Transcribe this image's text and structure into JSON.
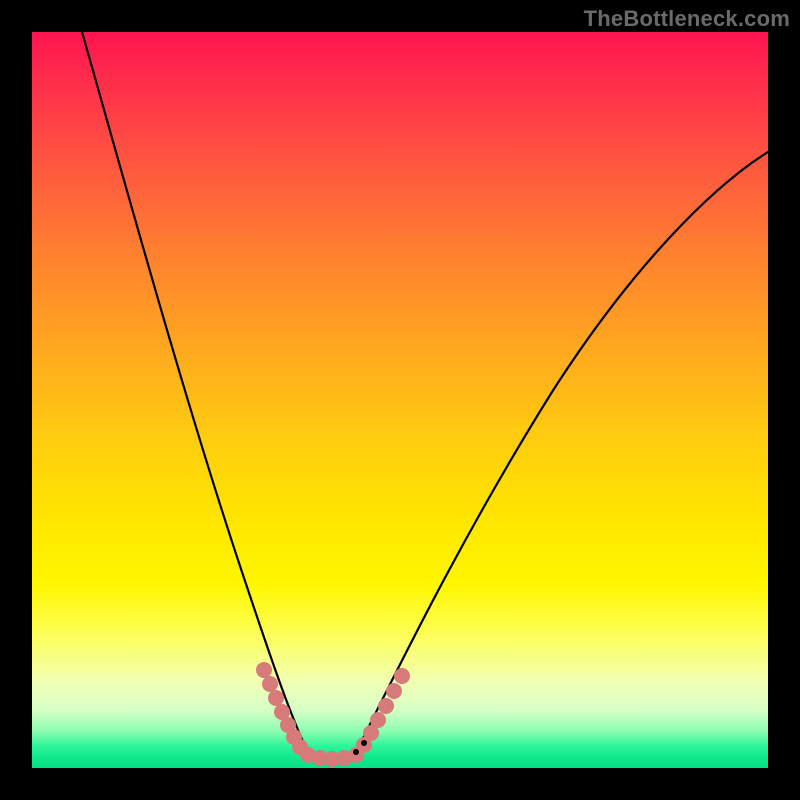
{
  "watermark": {
    "text": "TheBottleneck.com"
  },
  "chart_data": {
    "type": "line",
    "title": "",
    "xlabel": "",
    "ylabel": "",
    "xlim": [
      0,
      100
    ],
    "ylim": [
      0,
      100
    ],
    "series": [
      {
        "name": "left-curve",
        "x": [
          0,
          5,
          10,
          15,
          20,
          25,
          30,
          34,
          36,
          37.5
        ],
        "y": [
          100,
          84,
          68,
          53,
          39,
          26,
          15,
          6,
          2.5,
          1
        ]
      },
      {
        "name": "right-curve",
        "x": [
          44,
          46,
          50,
          55,
          60,
          65,
          70,
          75,
          80,
          85,
          90,
          95,
          100
        ],
        "y": [
          1,
          2.5,
          6,
          12,
          19,
          27,
          35,
          43,
          51,
          58,
          64,
          69,
          73
        ]
      },
      {
        "name": "valley-floor",
        "x": [
          37.5,
          44
        ],
        "y": [
          1,
          1
        ]
      },
      {
        "name": "pink-marker-left",
        "x": [
          31,
          32,
          33,
          34,
          35,
          36,
          37
        ],
        "y": [
          12.5,
          10,
          8,
          6,
          4.5,
          3,
          2
        ]
      },
      {
        "name": "pink-marker-bottom",
        "x": [
          37.5,
          39,
          41,
          43,
          44
        ],
        "y": [
          1.2,
          1,
          1,
          1,
          1.2
        ]
      },
      {
        "name": "pink-marker-right",
        "x": [
          45,
          46,
          47,
          48,
          49,
          50
        ],
        "y": [
          2,
          3,
          4,
          5.2,
          6.5,
          8
        ]
      }
    ],
    "gradient_stops": [
      {
        "pos": 0.0,
        "color": "#ff1450"
      },
      {
        "pos": 0.18,
        "color": "#ff5740"
      },
      {
        "pos": 0.42,
        "color": "#ffa520"
      },
      {
        "pos": 0.66,
        "color": "#ffe500"
      },
      {
        "pos": 0.88,
        "color": "#f2ffb0"
      },
      {
        "pos": 0.97,
        "color": "#2ff59a"
      },
      {
        "pos": 1.0,
        "color": "#07df86"
      }
    ]
  }
}
